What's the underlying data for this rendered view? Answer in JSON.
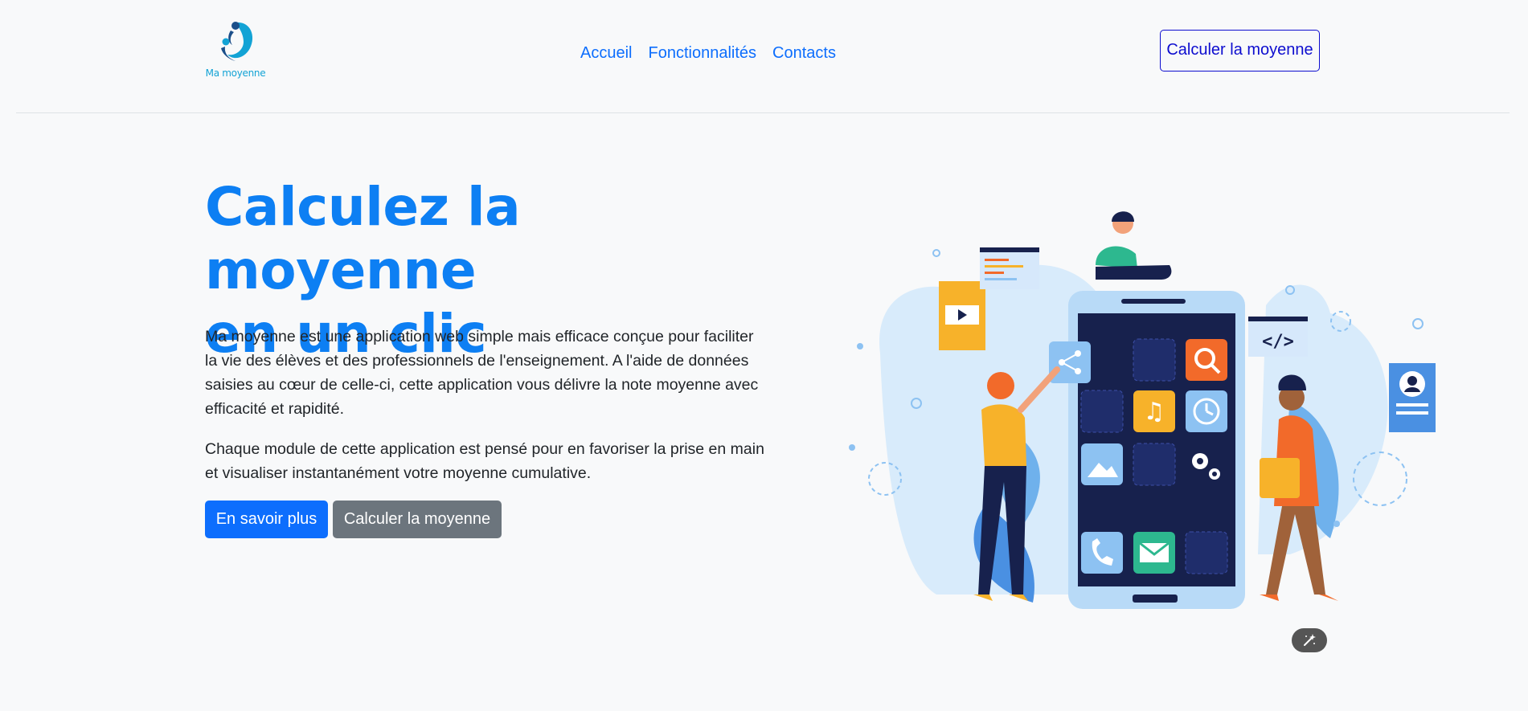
{
  "header": {
    "logo_text": "Ma moyenne",
    "nav": [
      {
        "label": "Accueil"
      },
      {
        "label": "Fonctionnalités"
      },
      {
        "label": "Contacts"
      }
    ],
    "cta_label": "Calculer la moyenne"
  },
  "hero": {
    "title_line1": "Calculez la moyenne",
    "title_line2": "en un clic",
    "paragraph1": "Ma moyenne est une application web simple mais efficace conçue pour faciliter la vie des élèves et des professionnels de l'enseignement. A l'aide de données saisies au cœur de celle-ci, cette application vous délivre la note moyenne avec efficacité et rapidité.",
    "paragraph2": "Chaque module de cette application est pensé pour en favoriser la prise en main et visualiser instantanément votre moyenne cumulative.",
    "primary_button": "En savoir plus",
    "secondary_button": "Calculer la moyenne"
  },
  "colors": {
    "accent": "#0d6efd",
    "title": "#0d7ff3",
    "secondary": "#6c757d",
    "background": "#f8f9fa",
    "logo": "#13a3d5"
  },
  "icons": {
    "illustration": "people-with-phone-apps-illustration",
    "floating_button": "magic-wand-icon"
  }
}
